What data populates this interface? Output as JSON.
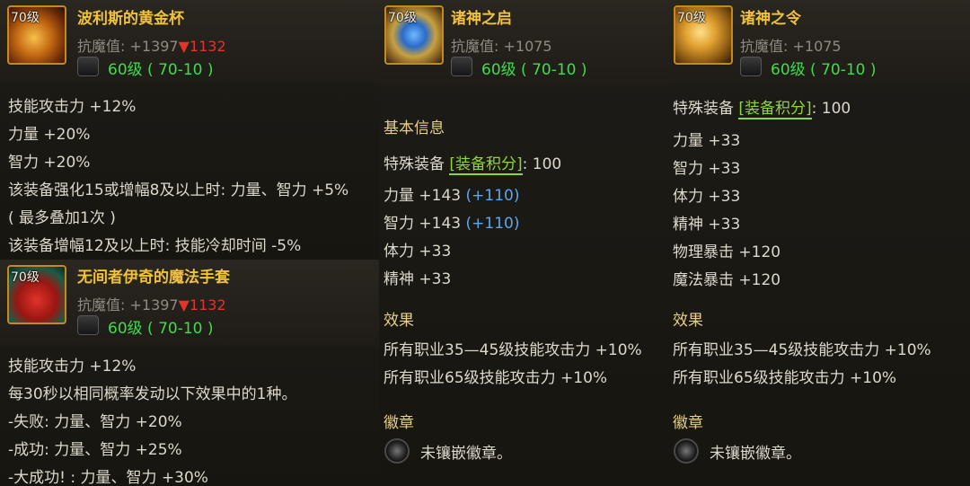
{
  "items": {
    "gold_cup": {
      "level_badge": "70级",
      "name": "波利斯的黄金杯",
      "resist_label": "抗魔值: +1397",
      "resist_diff": "▼1132",
      "req": "60级 ( 70-10 )",
      "lines": [
        "技能攻击力 +12%",
        "力量 +20%",
        "智力 +20%",
        "该装备强化15或增幅8及以上时: 力量、智力 +5%",
        "( 最多叠加1次 )",
        "该装备增幅12及以上时: 技能冷却时间 -5%"
      ]
    },
    "gloves": {
      "level_badge": "70级",
      "name": "无间者伊奇的魔法手套",
      "resist_label": "抗魔值: +1397",
      "resist_diff": "▼1132",
      "req": "60级 ( 70-10 )",
      "lines": [
        "技能攻击力 +12%",
        "每30秒以相同概率发动以下效果中的1种。",
        "-失败: 力量、智力 +20%",
        "-成功: 力量、智力 +25%",
        "-大成功! : 力量、智力 +30%"
      ]
    },
    "dawn": {
      "level_badge": "70级",
      "name": "诸神之启",
      "resist_label": "抗魔值: +1075",
      "req": "60级 ( 70-10 )",
      "basic_info": "基本信息",
      "special_prefix": "特殊装备 ",
      "special_tag": "[装备积分]",
      "special_suffix": ": 100",
      "str": "力量 +143 ",
      "str_bonus": "(+110)",
      "int": "智力 +143 ",
      "int_bonus": "(+110)",
      "vit": "体力 +33",
      "spr": "精神 +33",
      "effect_head": "效果",
      "effect_1": "所有职业35—45级技能攻击力 +10%",
      "effect_2": "所有职业65级技能攻击力 +10%",
      "emblem_head": "徽章",
      "emblem_text": "未镶嵌徽章。"
    },
    "command": {
      "level_badge": "70级",
      "name": "诸神之令",
      "resist_label": "抗魔值: +1075",
      "req": "60级 ( 70-10 )",
      "special_prefix": "特殊装备 ",
      "special_tag": "[装备积分]",
      "special_suffix": ": 100",
      "lines": [
        "力量 +33",
        "智力 +33",
        "体力 +33",
        "精神 +33",
        "物理暴击 +120",
        "魔法暴击 +120"
      ],
      "effect_head": "效果",
      "effect_1": "所有职业35—45级技能攻击力 +10%",
      "effect_2": "所有职业65级技能攻击力 +10%",
      "emblem_head": "徽章",
      "emblem_text": "未镶嵌徽章。"
    }
  },
  "colors": {
    "title": "#f0c23b",
    "requirement": "#3fdc4c",
    "decrease": "#e2342a",
    "bonus": "#5aa7ee",
    "tag": "#8ed63a"
  }
}
